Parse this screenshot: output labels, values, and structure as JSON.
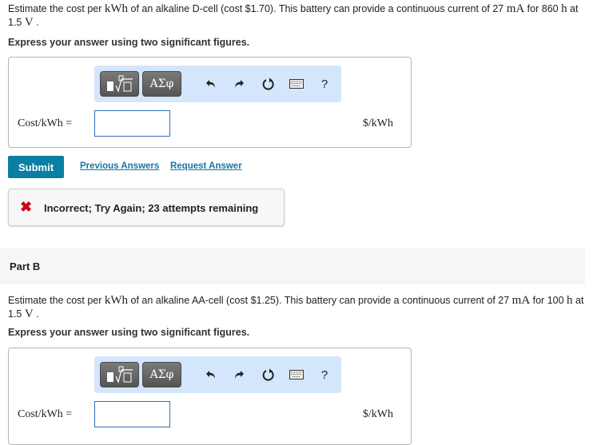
{
  "partA": {
    "question": {
      "pre": "Estimate the cost per ",
      "unit_kwh": "kWh",
      "mid1": " of an alkaline D-cell (cost $1.70). This battery can provide a continuous current of 27 ",
      "unit_ma": "mA",
      "mid2": " for 860 ",
      "unit_h": "h",
      "mid3": " at 1.5 ",
      "unit_v": "V",
      "end": " ."
    },
    "instruction": "Express your answer using two significant figures.",
    "answer": {
      "label": "Cost/kWh =",
      "value": "",
      "placeholder": "",
      "unit": "$/kWh"
    },
    "submit_label": "Submit",
    "previous_answers_label": "Previous Answers",
    "request_answer_label": "Request Answer",
    "feedback": {
      "status": "incorrect",
      "message": "Incorrect; Try Again; 23 attempts remaining"
    }
  },
  "toolbar": {
    "templates_icon": "templates-radical-icon",
    "greek_label": "ΑΣφ",
    "undo_icon": "undo-icon",
    "redo_icon": "redo-icon",
    "reset_icon": "reset-icon",
    "keyboard_icon": "keyboard-icon",
    "help_label": "?"
  },
  "partB": {
    "title": "Part B",
    "question": {
      "pre": "Estimate the cost per ",
      "unit_kwh": "kWh",
      "mid1": " of an alkaline AA-cell (cost $1.25). This battery can provide a continuous current of 27 ",
      "unit_ma": "mA",
      "mid2": " for 100 ",
      "unit_h": "h",
      "mid3": " at 1.5 ",
      "unit_v": "V",
      "end": " ."
    },
    "instruction": "Express your answer using two significant figures.",
    "answer": {
      "label": "Cost/kWh =",
      "value": "",
      "placeholder": "",
      "unit": "$/kWh"
    }
  },
  "colors": {
    "submit_bg": "#0b7ea4",
    "link": "#1a73a8",
    "error_x": "#d0021b",
    "toolbar_bg": "#d4e6fb",
    "input_border": "#2f6ec0"
  }
}
